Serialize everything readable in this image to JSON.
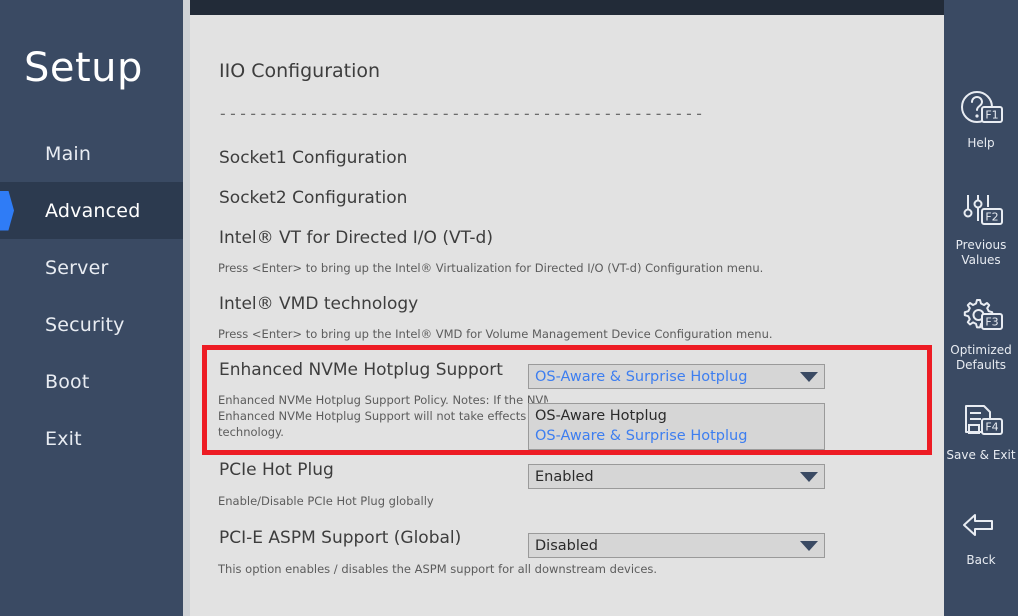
{
  "sidebar": {
    "title": "Setup",
    "items": [
      {
        "label": "Main",
        "active": false
      },
      {
        "label": "Advanced",
        "active": true
      },
      {
        "label": "Server",
        "active": false
      },
      {
        "label": "Security",
        "active": false
      },
      {
        "label": "Boot",
        "active": false
      },
      {
        "label": "Exit",
        "active": false
      }
    ]
  },
  "content": {
    "page_title": "IIO Configuration",
    "divider": "------------------------------------------------",
    "rows": [
      {
        "label": "Socket1 Configuration",
        "help": "",
        "field": null
      },
      {
        "label": "Socket2 Configuration",
        "help": "",
        "field": null
      },
      {
        "label": "Intel® VT for Directed I/O (VT-d)",
        "help": "Press <Enter> to bring up the Intel® Virtualization for Directed I/O (VT-d) Configuration menu.",
        "field": null
      },
      {
        "label": "Intel® VMD technology",
        "help": "Press <Enter> to bring up the Intel® VMD for Volume Management Device Configuration menu.",
        "field": null
      },
      {
        "label": "Enhanced NVMe Hotplug Support",
        "help_line1": "Enhanced NVMe Hotplug Support Policy. Notes: If the NVMe bridge Intel® IO VMD is already enabled,",
        "help_line2": "Enhanced NVMe Hotplug Support will not take effects and it will be managed by Intel® VMD",
        "help_line3": "technology.",
        "field_value": "OS-Aware & Surprise Hotplug",
        "field_state": "open",
        "options": [
          {
            "label": "OS-Aware Hotplug",
            "selected": false
          },
          {
            "label": "OS-Aware & Surprise Hotplug",
            "selected": true
          }
        ]
      },
      {
        "label": "PCIe Hot Plug",
        "help": "Enable/Disable PCIe Hot Plug globally",
        "field_value": "Enabled"
      },
      {
        "label": "PCI-E ASPM Support (Global)",
        "help": "This option enables / disables the ASPM support for all downstream devices.",
        "field_value": "Disabled"
      }
    ]
  },
  "rightbar": {
    "keys": [
      {
        "key": "F1",
        "icon": "help-question-icon",
        "caption": "Help"
      },
      {
        "key": "F2",
        "icon": "sliders-icon",
        "caption": "Previous\nValues"
      },
      {
        "key": "F3",
        "icon": "gear-icon",
        "caption": "Optimized\nDefaults"
      },
      {
        "key": "F4",
        "icon": "save-disk-icon",
        "caption": "Save & Exit"
      },
      {
        "key": "",
        "icon": "back-arrow-icon",
        "caption": "Back"
      }
    ]
  },
  "colors": {
    "sidebar_bg": "#3a4a63",
    "sidebar_active_bg": "#2c3a4f",
    "accent_blue": "#2f7cf6",
    "content_bg": "#e2e2e2",
    "highlight_red": "#ed1c24",
    "value_blue": "#3d7ef0"
  }
}
